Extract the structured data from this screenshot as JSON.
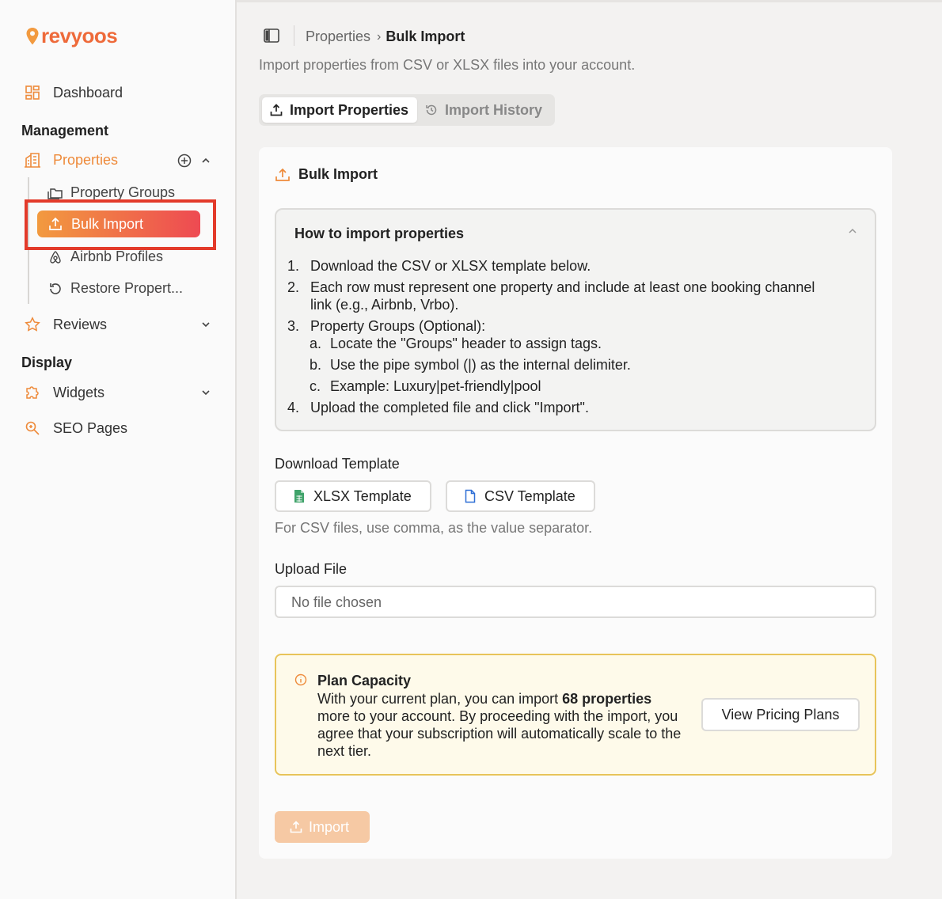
{
  "app": {
    "brand": "revyoos",
    "brand_color": "#ee6a3a",
    "accent_gradient": [
      "#f29a3f",
      "#ee4a52"
    ]
  },
  "sidebar": {
    "dashboard": {
      "label": "Dashboard",
      "icon": "dashboard-grid-icon"
    },
    "management_heading": "Management",
    "properties": {
      "label": "Properties",
      "icon": "building-icon",
      "expanded": true
    },
    "property_children": [
      {
        "label": "Property Groups",
        "icon": "folders-icon"
      },
      {
        "label": "Bulk Import",
        "icon": "upload-icon",
        "active": true
      },
      {
        "label": "Airbnb Profiles",
        "icon": "airbnb-icon"
      },
      {
        "label": "Restore Propert...",
        "icon": "restore-icon"
      }
    ],
    "reviews": {
      "label": "Reviews",
      "icon": "star-icon"
    },
    "display_heading": "Display",
    "widgets": {
      "label": "Widgets",
      "icon": "puzzle-icon"
    },
    "seo": {
      "label": "SEO Pages",
      "icon": "seo-search-icon"
    }
  },
  "header": {
    "breadcrumb": [
      "Properties",
      "Bulk Import"
    ],
    "description": "Import properties from CSV or XLSX files into your account."
  },
  "tabs": [
    {
      "label": "Import Properties",
      "icon": "upload-icon",
      "active": true
    },
    {
      "label": "Import History",
      "icon": "history-icon",
      "active": false
    }
  ],
  "card": {
    "title": "Bulk Import",
    "howto": {
      "title": "How to import properties",
      "steps": [
        {
          "num": "1.",
          "text": "Download the CSV or XLSX template below."
        },
        {
          "num": "2.",
          "text": "Each row must represent one property and include at least one booking channel",
          "text2": "link (e.g., Airbnb, Vrbo)."
        },
        {
          "num": "3.",
          "text": "Property Groups (Optional):"
        },
        {
          "num": "4.",
          "text": "Upload the completed file and click \"Import\"."
        }
      ],
      "substeps": [
        {
          "num": "a.",
          "text": "Locate the \"Groups\" header to assign tags."
        },
        {
          "num": "b.",
          "text": "Use the pipe symbol (|) as the internal delimiter."
        },
        {
          "num": "c.",
          "text": "Example: Luxury|pet-friendly|pool"
        }
      ]
    },
    "download_label": "Download Template",
    "xlsx_button": "XLSX Template",
    "csv_button": "CSV Template",
    "hint": "For CSV files, use comma, as the value separator.",
    "upload_label": "Upload File",
    "file_placeholder": "No file chosen",
    "plan": {
      "title": "Plan Capacity",
      "text_before": "With your current plan, you can import ",
      "count": "68 properties",
      "text_after": " more to your account. By proceeding with the import, you agree that your subscription will automatically scale to the next tier.",
      "button": "View Pricing Plans"
    },
    "import_button": "Import"
  }
}
